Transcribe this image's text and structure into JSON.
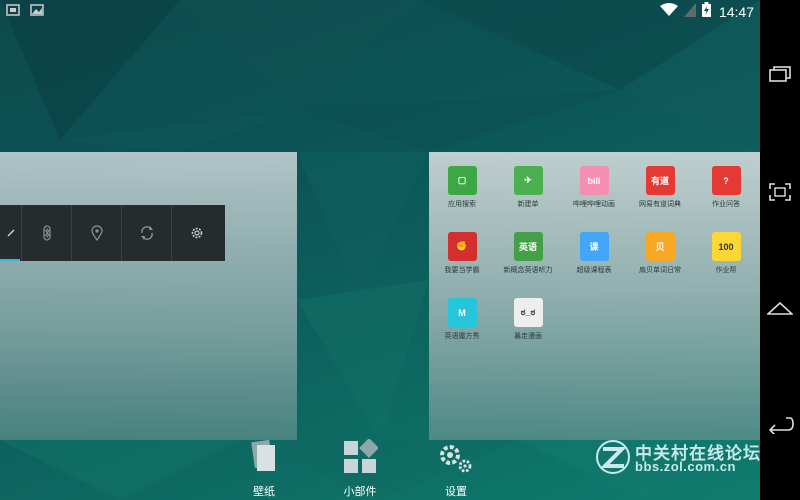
{
  "status_bar": {
    "time": "14:47",
    "left_icons": [
      "screenshot-notification-icon",
      "image-notification-icon"
    ],
    "right_icons": [
      "wifi-icon",
      "signal-icon",
      "battery-charging-icon"
    ]
  },
  "nav_bar": {
    "buttons": [
      "recent-apps-icon",
      "screenshot-frame-icon",
      "home-icon",
      "back-icon"
    ]
  },
  "quick_settings": {
    "tiles": [
      "brightness-icon",
      "bluetooth-icon",
      "location-icon",
      "sync-icon",
      "settings-icon"
    ]
  },
  "apps": [
    {
      "label": "应用搜索",
      "color": "#3da843",
      "glyph": "▢",
      "icon": "android-market-icon"
    },
    {
      "label": "新建单",
      "color": "#4caf50",
      "glyph": "✈",
      "icon": "paper-plane-icon"
    },
    {
      "label": "哔哩哔哩动画",
      "color": "#f48fb1",
      "glyph": "bili",
      "icon": "bilibili-icon"
    },
    {
      "label": "网易有道词典",
      "color": "#e53935",
      "glyph": "有道",
      "icon": "youdao-icon"
    },
    {
      "label": "作业问答",
      "color": "#e53935",
      "glyph": "?",
      "icon": "question-icon"
    },
    {
      "label": "我要当学霸",
      "color": "#d32f2f",
      "glyph": "✊",
      "icon": "fist-icon"
    },
    {
      "label": "新概念英语听力",
      "color": "#43a047",
      "glyph": "英语",
      "icon": "english-listening-icon"
    },
    {
      "label": "超级课程表",
      "color": "#42a5f5",
      "glyph": "课",
      "icon": "schedule-icon"
    },
    {
      "label": "扇贝单词日常",
      "color": "#f9a825",
      "glyph": "贝",
      "icon": "shanbay-icon"
    },
    {
      "label": "作业帮",
      "color": "#fdd835",
      "glyph": "100",
      "icon": "homework-help-icon"
    },
    {
      "label": "英语魔方秀",
      "color": "#26c6da",
      "glyph": "M",
      "icon": "magic-cube-icon"
    },
    {
      "label": "暴走漫画",
      "color": "#eeeeee",
      "glyph": "ಠ_ಠ",
      "icon": "rage-comic-icon"
    }
  ],
  "edit_options": [
    {
      "label": "壁纸",
      "icon": "wallpaper-icon"
    },
    {
      "label": "小部件",
      "icon": "widgets-icon"
    },
    {
      "label": "设置",
      "icon": "settings-gears-icon"
    }
  ],
  "watermark": {
    "title": "中关村在线论坛",
    "url": "bbs.zol.com.cn"
  }
}
